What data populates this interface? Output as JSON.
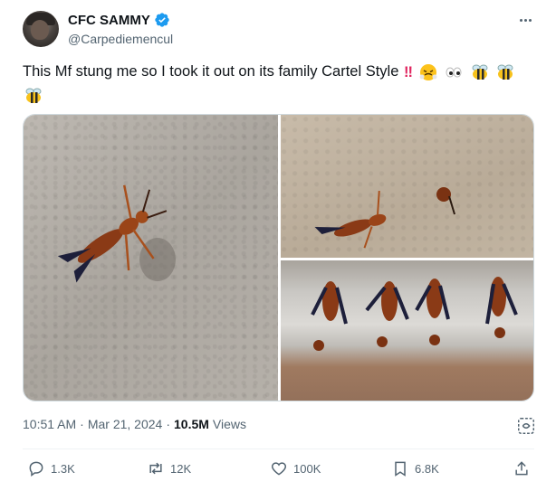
{
  "author": {
    "display_name": "CFC SAMMY",
    "handle": "@Carpediemencul",
    "verified": true
  },
  "tweet": {
    "text": "This Mf stung me so I took it out on its family Cartel Style",
    "emojis": [
      "double-exclamation",
      "face-with-steam",
      "eyes",
      "honeybee",
      "honeybee",
      "honeybee"
    ]
  },
  "meta": {
    "time": "10:51 AM",
    "date": "Mar 21, 2024",
    "views_count": "10.5M",
    "views_label": "Views"
  },
  "actions": {
    "replies": "1.3K",
    "reposts": "12K",
    "likes": "100K",
    "bookmarks": "6.8K"
  },
  "colors": {
    "text_primary": "#0f1419",
    "text_secondary": "#536471",
    "verified_blue": "#1d9bf0",
    "border": "#cfd9de"
  }
}
